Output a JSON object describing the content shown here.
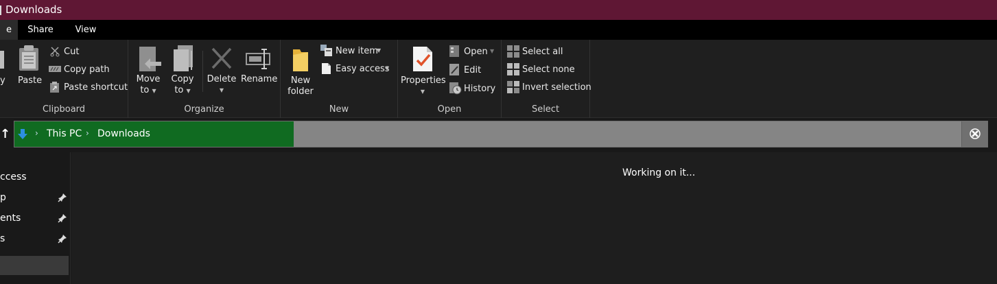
{
  "window": {
    "title": "Downloads"
  },
  "tabs": [
    {
      "label": "e",
      "active": true
    },
    {
      "label": "Share",
      "active": false
    },
    {
      "label": "View",
      "active": false
    }
  ],
  "ribbon": {
    "clipboard": {
      "label": "Clipboard",
      "copy_label": "y",
      "paste_label": "Paste",
      "cut_label": "Cut",
      "copy_path_label": "Copy path",
      "paste_shortcut_label": "Paste shortcut"
    },
    "organize": {
      "label": "Organize",
      "move_to_line1": "Move",
      "move_to_line2": "to",
      "copy_to_line1": "Copy",
      "copy_to_line2": "to",
      "delete_label": "Delete",
      "rename_label": "Rename"
    },
    "new": {
      "label": "New",
      "new_folder_line1": "New",
      "new_folder_line2": "folder",
      "new_item_label": "New item",
      "easy_access_label": "Easy access"
    },
    "open": {
      "label": "Open",
      "properties_label": "Properties",
      "open_label": "Open",
      "edit_label": "Edit",
      "history_label": "History"
    },
    "select": {
      "label": "Select",
      "select_all_label": "Select all",
      "select_none_label": "Select none",
      "invert_selection_label": "Invert selection"
    }
  },
  "address": {
    "up_glyph": "↑",
    "crumbs": [
      "This PC",
      "Downloads"
    ],
    "cancel_icon": "close-icon"
  },
  "nav": {
    "items": [
      "ccess",
      "p",
      "ents",
      "s"
    ]
  },
  "content": {
    "status": "Working on it..."
  },
  "colors": {
    "titlebar": "#5f1734",
    "progress": "#106b21",
    "accent_blue": "#2d8fe0"
  }
}
